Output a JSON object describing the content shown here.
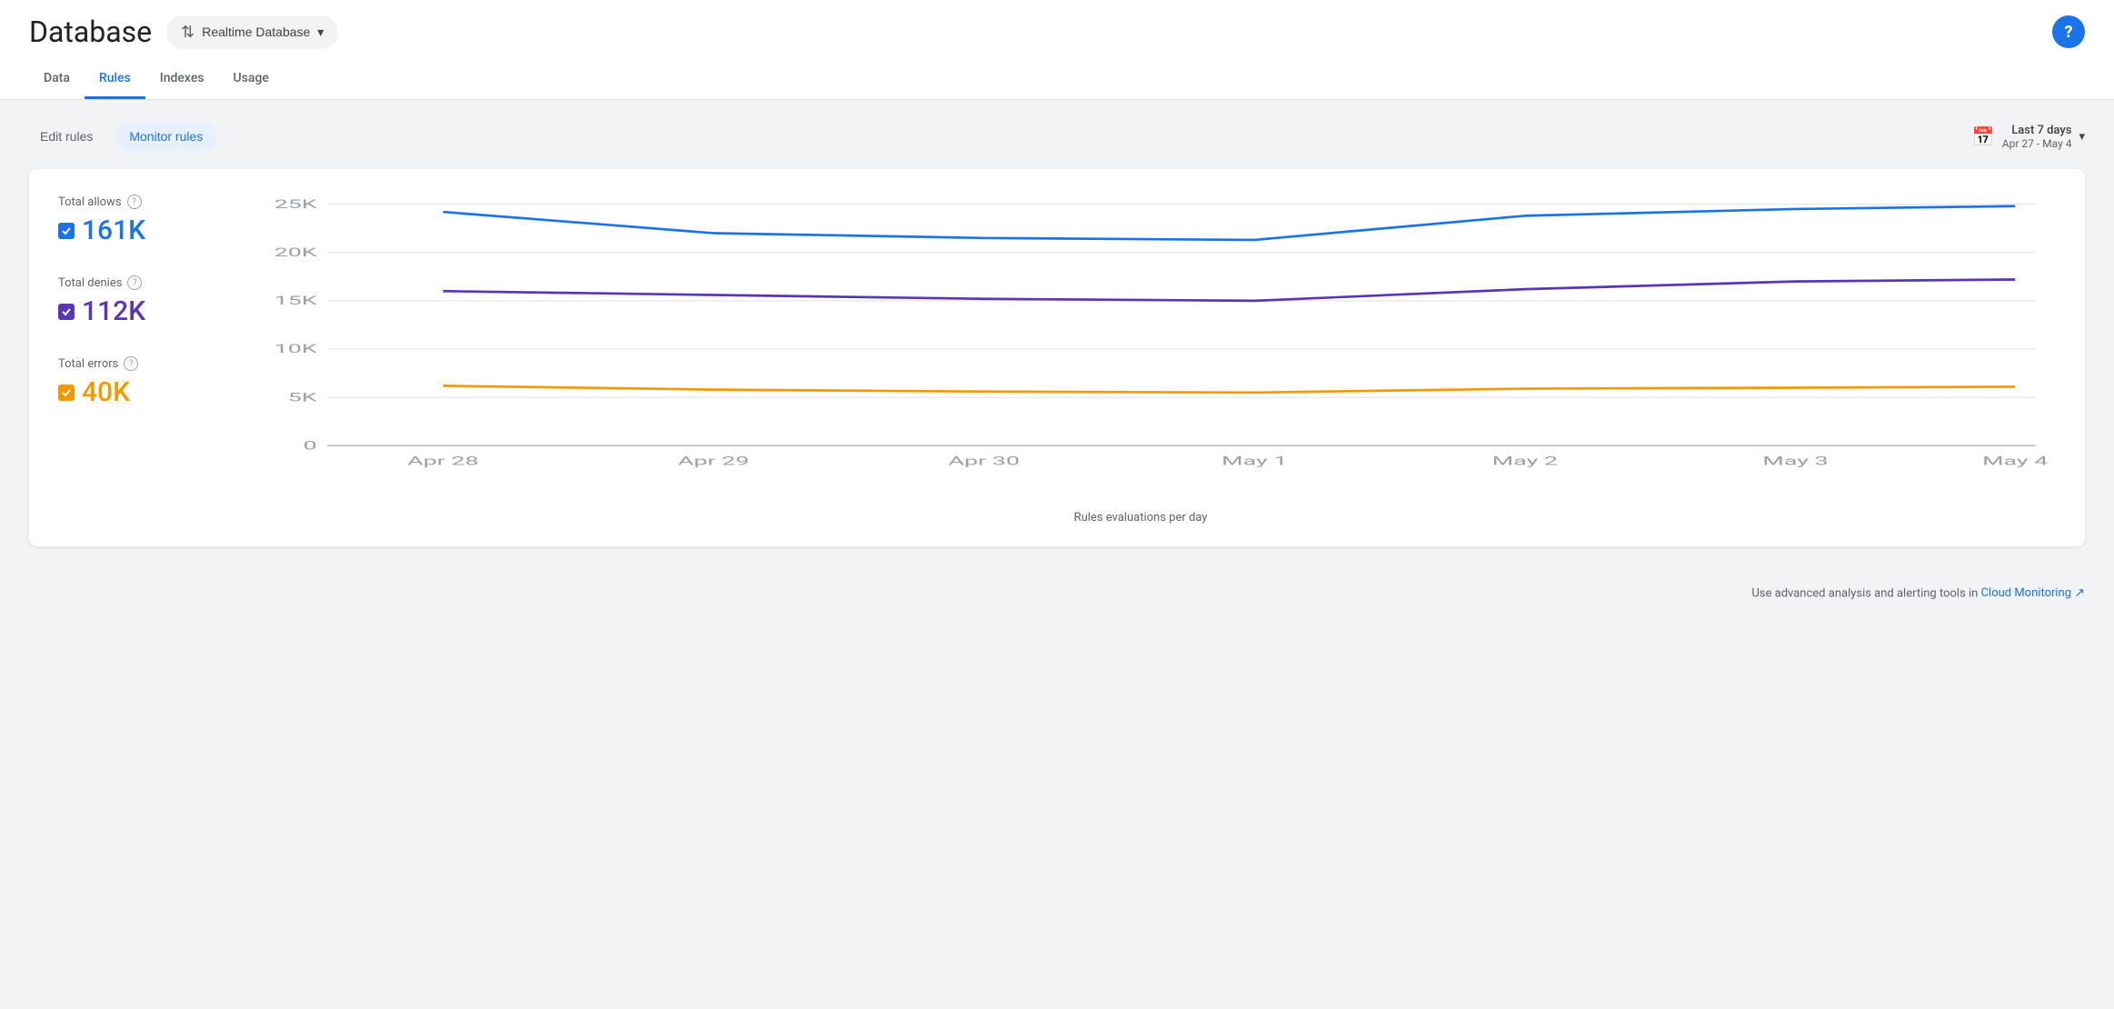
{
  "header": {
    "title": "Database",
    "db_selector_label": "Realtime Database",
    "help_icon": "?"
  },
  "nav": {
    "tabs": [
      {
        "id": "data",
        "label": "Data",
        "active": false
      },
      {
        "id": "rules",
        "label": "Rules",
        "active": true
      },
      {
        "id": "indexes",
        "label": "Indexes",
        "active": false
      },
      {
        "id": "usage",
        "label": "Usage",
        "active": false
      }
    ]
  },
  "controls": {
    "edit_rules_label": "Edit rules",
    "monitor_rules_label": "Monitor rules",
    "date_range_main": "Last 7 days",
    "date_range_sub": "Apr 27 - May 4"
  },
  "legend": {
    "allows": {
      "label": "Total allows",
      "value": "161K",
      "color": "#1a73e8"
    },
    "denies": {
      "label": "Total denies",
      "value": "112K",
      "color": "#5c35b5"
    },
    "errors": {
      "label": "Total errors",
      "value": "40K",
      "color": "#f29900"
    }
  },
  "chart": {
    "y_labels": [
      "25K",
      "20K",
      "15K",
      "10K",
      "5K",
      "0"
    ],
    "x_labels": [
      "Apr 28",
      "Apr 29",
      "Apr 30",
      "May 1",
      "May 2",
      "May 3",
      "May 4"
    ],
    "x_axis_label": "Rules evaluations per day",
    "blue_line": [
      24200,
      22000,
      21500,
      21300,
      23800,
      24500,
      24800
    ],
    "purple_line": [
      16000,
      15600,
      15200,
      15000,
      16200,
      17000,
      17200
    ],
    "yellow_line": [
      6200,
      5800,
      5600,
      5500,
      5900,
      6000,
      6100
    ]
  },
  "footer": {
    "text": "Use advanced analysis and alerting tools in",
    "link_label": "Cloud Monitoring"
  }
}
